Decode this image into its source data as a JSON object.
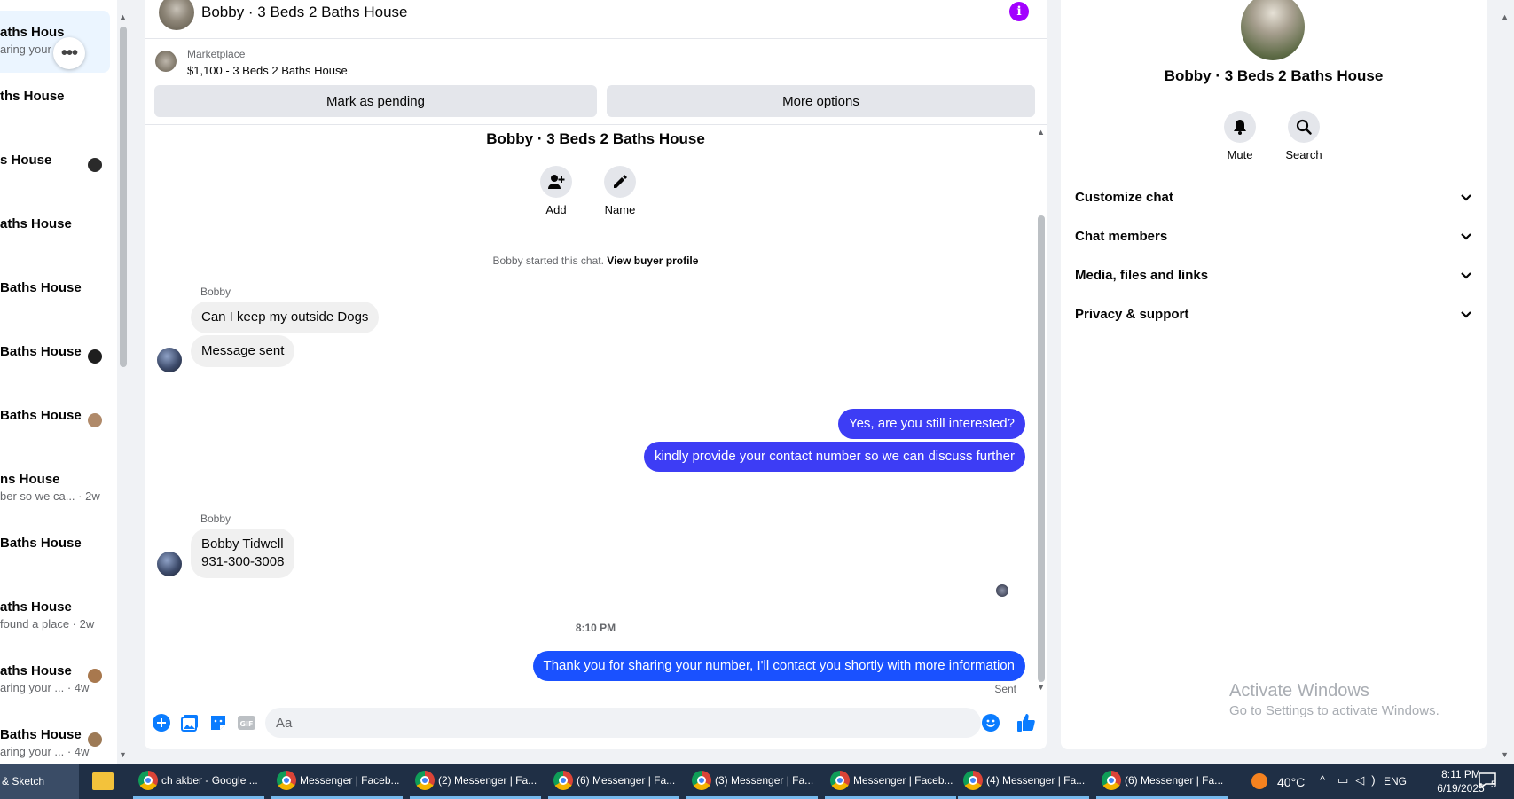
{
  "conversation_list": {
    "items": [
      {
        "title": "aths Hous",
        "subtitle": "aring your n    m",
        "dot_color": ""
      },
      {
        "title": "ths House",
        "subtitle": "",
        "dot_color": ""
      },
      {
        "title": "s House",
        "subtitle": "",
        "dot_color": "#2a2a2a"
      },
      {
        "title": "aths House",
        "subtitle": "",
        "dot_color": ""
      },
      {
        "title": "Baths House",
        "subtitle": "",
        "dot_color": ""
      },
      {
        "title": " Baths House",
        "subtitle": "",
        "dot_color": "#1e1e1e"
      },
      {
        "title": "Baths House",
        "subtitle": "",
        "dot_color": "#b08a6a"
      },
      {
        "title": "ns House",
        "subtitle": "ber so we ca... · 2w",
        "dot_color": ""
      },
      {
        "title": "Baths House",
        "subtitle": "",
        "dot_color": ""
      },
      {
        "title": "aths House",
        "subtitle": " found a place · 2w",
        "dot_color": ""
      },
      {
        "title": "aths House",
        "subtitle": "aring your ... · 4w",
        "dot_color": "#a8784e"
      },
      {
        "title": "Baths House",
        "subtitle": "aring your ... · 4w",
        "dot_color": "#9d7a56"
      }
    ]
  },
  "chat": {
    "header_title": "Bobby · 3 Beds 2 Baths House",
    "marketplace_label": "Marketplace",
    "marketplace_listing": "$1,100 - 3 Beds 2 Baths House",
    "mark_pending_label": "Mark as pending",
    "more_options_label": "More options",
    "center_title": "Bobby · 3 Beds 2 Baths House",
    "add_label": "Add",
    "name_label": "Name",
    "started_text": "Bobby started this chat. ",
    "view_profile_link": "View buyer profile",
    "messages": {
      "sender_1": "Bobby",
      "in_1": "Can I keep my outside Dogs",
      "in_2": "Message sent",
      "out_1": "Yes, are you still interested?",
      "out_2": "kindly provide your contact number so we can discuss further",
      "sender_2": "Bobby",
      "in_3_line1": "Bobby Tidwell",
      "in_3_line2": "931-300-3008",
      "time": "8:10 PM",
      "out_3": "Thank you for sharing your number, I'll contact you shortly with more information",
      "sent_status": "Sent"
    },
    "composer_placeholder": "Aa"
  },
  "info_panel": {
    "title": "Bobby · 3 Beds 2 Baths House",
    "mute_label": "Mute",
    "search_label": "Search",
    "sections": [
      "Customize chat",
      "Chat members",
      "Media, files and links",
      "Privacy & support"
    ]
  },
  "watermark": {
    "line1": "Activate Windows",
    "line2": "Go to Settings to activate Windows."
  },
  "taskbar": {
    "left_label": "& Sketch",
    "items": [
      "ch akber - Google ...",
      "Messenger | Faceb...",
      "(2) Messenger | Fa...",
      "(6) Messenger | Fa...",
      "(3) Messenger | Fa...",
      "Messenger | Faceb...",
      "(4) Messenger | Fa...",
      "(6) Messenger | Fa..."
    ],
    "temperature": "40°C",
    "language": "ENG",
    "time": "8:11 PM",
    "date": "6/19/2025",
    "notification_count": "5"
  },
  "colors": {
    "accent": "#0a7cff",
    "out_bubble": "#1a51ff",
    "info_icon": "#a200ff"
  }
}
